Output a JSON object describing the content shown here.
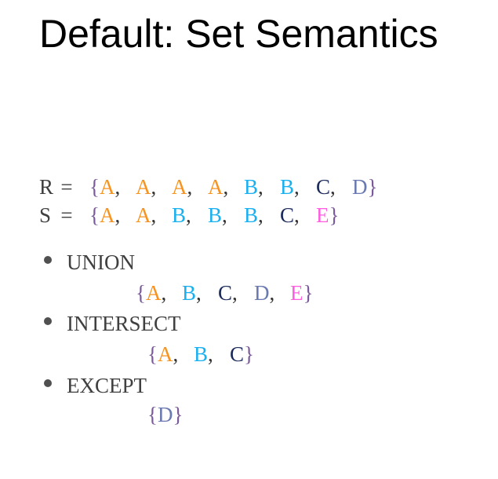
{
  "title": "Default: Set Semantics",
  "colors": {
    "A": "#f7931e",
    "B": "#1ab0f0",
    "C": "#1a2a5a",
    "D": "#6a7ab0",
    "E": "#ff5ee0"
  },
  "relations": [
    {
      "name": "R",
      "equals": "=",
      "elements": [
        "A",
        "A",
        "A",
        "A",
        "B",
        "B",
        "C",
        "D"
      ]
    },
    {
      "name": "S",
      "equals": "=",
      "elements": [
        "A",
        "A",
        "B",
        "B",
        "B",
        "C",
        "E"
      ]
    }
  ],
  "operations": [
    {
      "label": "UNION",
      "result": [
        "A",
        "B",
        "C",
        "D",
        "E"
      ]
    },
    {
      "label": "INTERSECT",
      "result": [
        "A",
        "B",
        "C"
      ]
    },
    {
      "label": "EXCEPT",
      "result": [
        "D"
      ]
    }
  ],
  "punct": {
    "open": "{",
    "close": "}",
    "comma": ","
  }
}
